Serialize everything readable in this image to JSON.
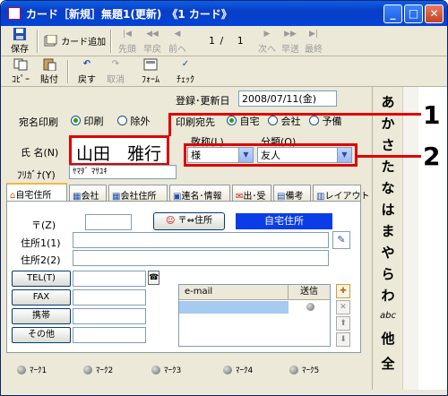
{
  "window": {
    "title": "カード［新規］無題1(更新)　《1 カード》",
    "min": "_",
    "max": "□",
    "close": "✕"
  },
  "toolbar1": {
    "save": "保存",
    "add_card": "カード追加",
    "first": "先頭",
    "prev_fast": "早戻",
    "prev": "前へ",
    "page_current": "1",
    "page_sep": "/",
    "page_total": "1",
    "next": "次へ",
    "next_fast": "早送",
    "last": "最終"
  },
  "toolbar2": {
    "copy": "ｺﾋﾟｰ",
    "paste": "貼付",
    "undo": "戻す",
    "cancel": "取消",
    "form": "ﾌｫｰﾑ",
    "check": "ﾁｪｯｸ"
  },
  "form": {
    "reg_date_label": "登録･更新日",
    "reg_date_value": "2008/07/11(金)",
    "address_print_label": "宛名印刷",
    "print_on": "印刷",
    "print_off": "除外",
    "print_dest_label": "印刷宛先",
    "dest_home": "自宅",
    "dest_company": "会社",
    "dest_backup": "予備",
    "name_label": "氏 名(N)",
    "name_value": "山田　雅行",
    "furigana_label": "ﾌﾘｶﾞﾅ(Y)",
    "furigana_value": "ﾔﾏﾀﾞ ﾏｻﾕｷ",
    "honorific_label": "敬称(L)",
    "honorific_value": "様",
    "category_label": "分類(Q)",
    "category_value": "友人"
  },
  "tabs": [
    "自宅住所",
    "会社",
    "会社住所",
    "連名･情報",
    "出･受",
    "備考",
    "レイアウト"
  ],
  "home": {
    "zip_label": "〒(Z)",
    "swap_label": "〒⇔住所",
    "address_type": "自宅住所",
    "addr1_label": "住所1(1)",
    "addr2_label": "住所2(2)",
    "tel_button": "TEL(T)",
    "fax_button": "FAX",
    "mobile_button": "携帯",
    "other_button": "その他",
    "email_col": "e-mail",
    "send_col": "送信"
  },
  "marks": [
    "ﾏｰｸ1",
    "ﾏｰｸ2",
    "ﾏｰｸ3",
    "ﾏｰｸ4",
    "ﾏｰｸ5"
  ],
  "kana_index": [
    "あ",
    "か",
    "さ",
    "た",
    "な",
    "は",
    "ま",
    "や",
    "ら",
    "わ",
    "abc",
    "他",
    "全"
  ],
  "callouts": [
    "1",
    "2"
  ]
}
